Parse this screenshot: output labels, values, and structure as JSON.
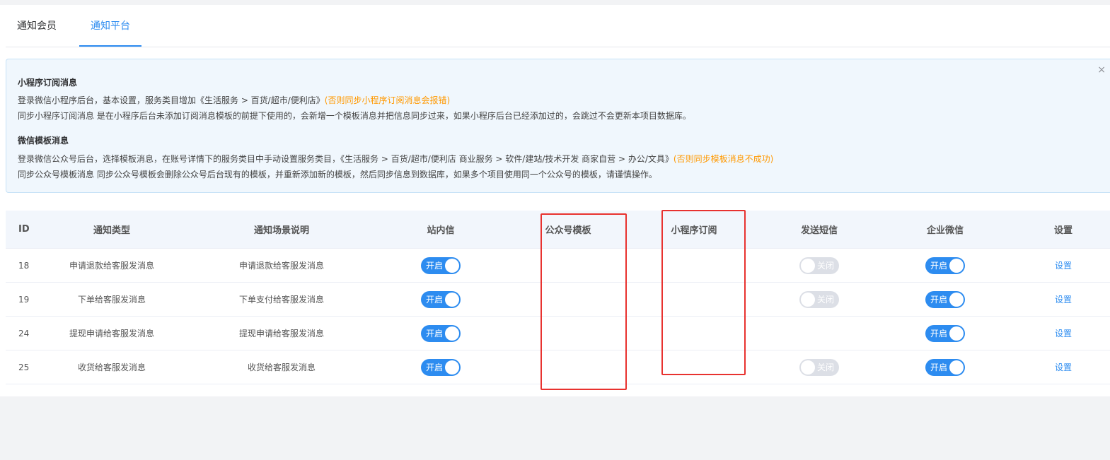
{
  "tabs": [
    {
      "label": "通知会员"
    },
    {
      "label": "通知平台"
    }
  ],
  "alert": {
    "close_icon": "×",
    "mini": {
      "title": "小程序订阅消息",
      "line1": "登录微信小程序后台，基本设置，服务类目增加《生活服务 > 百货/超市/便利店》",
      "line1_warn": "(否则同步小程序订阅消息会报错)",
      "line2": "同步小程序订阅消息 是在小程序后台未添加订阅消息模板的前提下使用的，会新增一个模板消息并把信息同步过来，如果小程序后台已经添加过的，会跳过不会更新本项目数据库。"
    },
    "wx": {
      "title": "微信模板消息",
      "line1": "登录微信公众号后台，选择模板消息，在账号详情下的服务类目中手动设置服务类目，《生活服务 > 百货/超市/便利店 商业服务 > 软件/建站/技术开发 商家自营 > 办公/文具》",
      "line1_warn": "(否则同步模板消息不成功)",
      "line2": "同步公众号模板消息 同步公众号模板会删除公众号后台现有的模板，并重新添加新的模板，然后同步信息到数据库，如果多个项目使用同一个公众号的模板，请谨慎操作。"
    }
  },
  "table": {
    "headers": {
      "id": "ID",
      "type": "通知类型",
      "scene": "通知场景说明",
      "site": "站内信",
      "gzh": "公众号模板",
      "mini": "小程序订阅",
      "sms": "发送短信",
      "wx": "企业微信",
      "settings": "设置"
    },
    "switch_on_label": "开启",
    "switch_off_label": "关闭",
    "rows": [
      {
        "id": "18",
        "type": "申请退款给客服发消息",
        "scene": "申请退款给客服发消息",
        "site": "on",
        "sms": "off",
        "wx": "on",
        "settings": "设置"
      },
      {
        "id": "19",
        "type": "下单给客服发消息",
        "scene": "下单支付给客服发消息",
        "site": "on",
        "sms": "off",
        "wx": "on",
        "settings": "设置"
      },
      {
        "id": "24",
        "type": "提现申请给客服发消息",
        "scene": "提现申请给客服发消息",
        "site": "on",
        "sms": "",
        "wx": "on",
        "settings": "设置"
      },
      {
        "id": "25",
        "type": "收货给客服发消息",
        "scene": "收货给客服发消息",
        "site": "on",
        "sms": "off",
        "wx": "on",
        "settings": "设置"
      }
    ]
  },
  "colors": {
    "primary": "#2d8cf0",
    "warn": "#ff9900",
    "annotation": "#e8322f",
    "switch_off": "#dcdfe6"
  }
}
